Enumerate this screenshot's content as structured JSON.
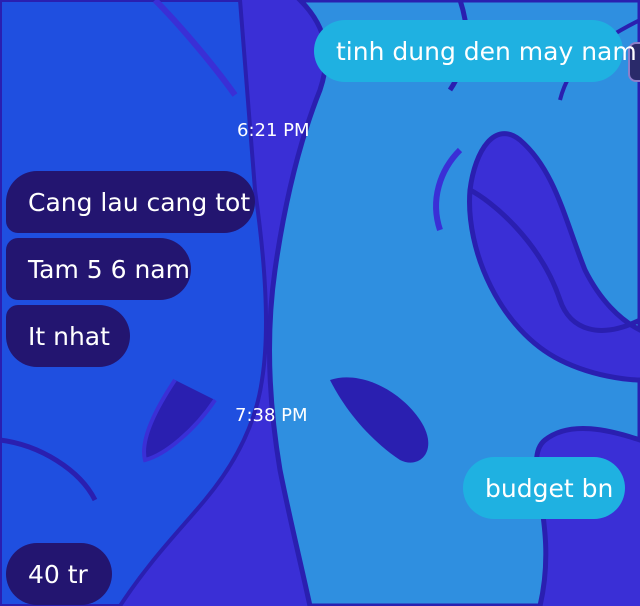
{
  "conversation": {
    "messages": [
      {
        "text": "tinh dung den may nam",
        "direction": "outgoing"
      },
      {
        "text": "Cang lau cang tot",
        "direction": "incoming"
      },
      {
        "text": "Tam 5 6 nam",
        "direction": "incoming"
      },
      {
        "text": "It nhat",
        "direction": "incoming"
      },
      {
        "text": "budget bn",
        "direction": "outgoing"
      },
      {
        "text": "40 tr",
        "direction": "incoming"
      }
    ],
    "timestamps": [
      "6:21 PM",
      "7:38 PM"
    ]
  },
  "theme": {
    "background": "#3a2fd6",
    "outgoing_bubble": "#1fb1e1",
    "incoming_bubble": "#231570",
    "text": "#ffffff"
  },
  "icons": {
    "avatar": "avatar-icon"
  }
}
